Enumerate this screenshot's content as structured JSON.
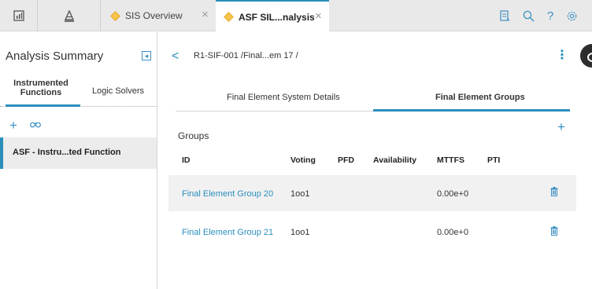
{
  "topbar": {
    "dashboard_icon": "dashboard-icon",
    "hierarchy_icon": "hierarchy-icon",
    "tabs": [
      {
        "label": "SIS Overview",
        "close": "×"
      },
      {
        "label": "ASF SIL...nalysis",
        "close": "×"
      }
    ],
    "right_icons": [
      "reports-icon",
      "search-icon",
      "help-icon",
      "settings-icon"
    ],
    "help_glyph": "?"
  },
  "left_panel": {
    "title": "Analysis Summary",
    "collapse_glyph": "◂",
    "tabs": [
      "Instrumented Functions",
      "Logic Solvers"
    ],
    "tab0_line1": "Instrumented",
    "tab0_line2": "Functions",
    "add_glyph": "+",
    "search_glyph": "&",
    "items": [
      {
        "label": "ASF - Instru...ted Function",
        "selected": true
      }
    ]
  },
  "main": {
    "back_glyph": "<",
    "breadcrumb": "R1-SIF-001 /Final...em 17 /",
    "menu_glyph": "⋮",
    "sub_tabs": [
      "Final Element System Details",
      "Final Element Groups"
    ],
    "groups_label": "Groups",
    "add_glyph": "+",
    "columns": [
      "ID",
      "Voting",
      "PFD",
      "Availability",
      "MTTFS",
      "PTI"
    ],
    "rows": [
      {
        "id": "Final Element Group 20",
        "voting": "1oo1",
        "pfd": "",
        "availability": "",
        "mttfs": "0.00e+0",
        "pti": ""
      },
      {
        "id": "Final Element Group 21",
        "voting": "1oo1",
        "pfd": "",
        "availability": "",
        "mttfs": "0.00e+0",
        "pti": ""
      }
    ]
  },
  "colors": {
    "accent": "#2a8fbd",
    "tab_diamond": "#f5c54a",
    "selected_row": "#ececec"
  }
}
